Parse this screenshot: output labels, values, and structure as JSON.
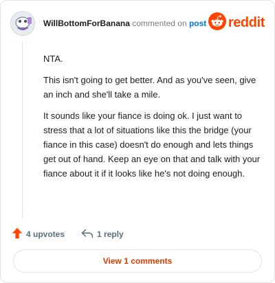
{
  "header": {
    "username": "WillBottomForBanana",
    "action_text": "commented on",
    "post_link": "post",
    "logo_text": "reddit"
  },
  "comment": {
    "paragraphs": [
      "NTA.",
      "This isn't going to get better. And as you've seen, give an inch and she'll take a mile.",
      "It sounds like your fiance is doing ok. I just want to stress that a lot of situations like this the bridge (your fiance in this case) doesn't do enough and lets things get out of hand. Keep an eye on that and talk with your fiance about it if it looks like he's not doing enough."
    ]
  },
  "actions": {
    "upvotes": "4 upvotes",
    "replies": "1 reply"
  },
  "footer": {
    "view_comments": "View 1 comments"
  },
  "colors": {
    "brand": "#ff4500",
    "link": "#0079d3",
    "view_button_text": "#d93a00"
  },
  "icons": [
    "avatar",
    "reddit-snoo-icon",
    "upvote-arrow-icon",
    "reply-arrow-icon"
  ]
}
